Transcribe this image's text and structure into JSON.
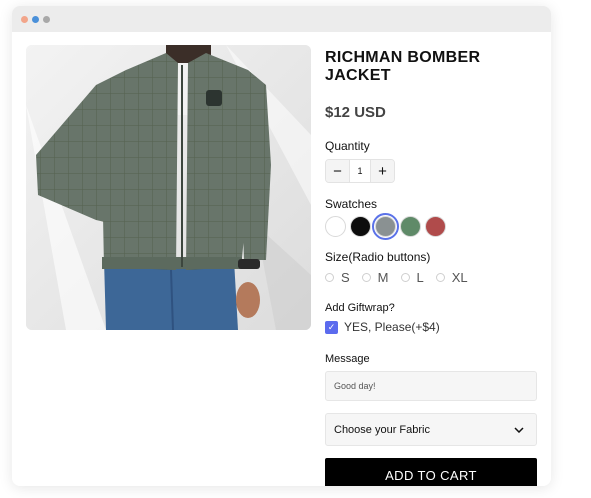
{
  "window": {
    "dots": [
      "#f2a58a",
      "#4a90d9",
      "#a8a8a8"
    ]
  },
  "product": {
    "image_icon": "jacket-photo",
    "title": "RICHMAN BOMBER JACKET",
    "price": "$12 USD"
  },
  "quantity": {
    "label": "Quantity",
    "minus": "−",
    "value": "1",
    "plus": "+"
  },
  "swatches": {
    "label": "Swatches",
    "colors": [
      "#ffffff",
      "#0d0d0d",
      "#8a9192",
      "#5f8a68",
      "#b04b4b"
    ],
    "selected_index": 2
  },
  "size": {
    "label": "Size(Radio buttons)",
    "options": [
      "S",
      "M",
      "L",
      "XL"
    ]
  },
  "giftwrap": {
    "label": "Add Giftwrap?",
    "option": "YES, Please(+$4)",
    "checked": true
  },
  "message": {
    "label": "Message",
    "value": "Good day!"
  },
  "fabric": {
    "placeholder": "Choose your Fabric"
  },
  "cart": {
    "button": "ADD TO CART"
  },
  "colors": {
    "accent": "#5b6bee",
    "cart_bg": "#000000"
  }
}
